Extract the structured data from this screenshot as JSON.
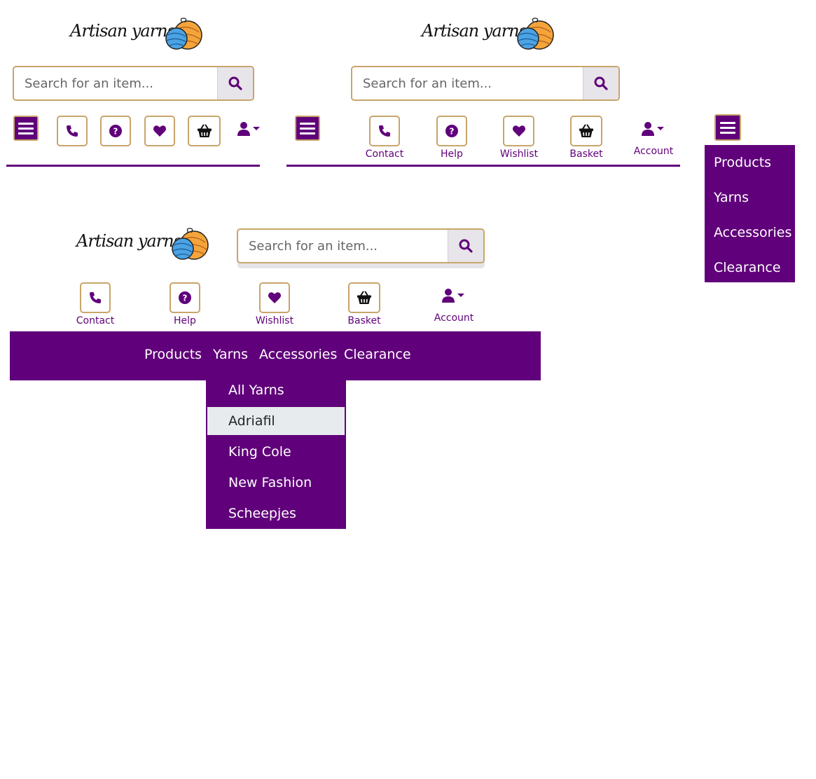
{
  "brand": {
    "name": "Artisan yarns"
  },
  "search": {
    "placeholder": "Search for an item..."
  },
  "colors": {
    "primary": "#60007a",
    "border": "#c8a56a",
    "highlight": "#e8ebee"
  },
  "icons": {
    "phone": "phone-icon",
    "help": "question-circle-icon",
    "wishlist": "heart-icon",
    "basket": "basket-icon",
    "account": "user-dropdown-icon",
    "menu": "hamburger-icon",
    "search": "search-icon"
  },
  "nav": {
    "contact": "Contact",
    "help": "Help",
    "wishlist": "Wishlist",
    "basket": "Basket",
    "account": "Account"
  },
  "menu": {
    "items": [
      "Products",
      "Yarns",
      "Accessories",
      "Clearance"
    ]
  },
  "yarns_dropdown": {
    "items": [
      "All Yarns",
      "Adriafil",
      "King Cole",
      "New Fashion",
      "Scheepjes"
    ],
    "active_item": "Adriafil"
  }
}
